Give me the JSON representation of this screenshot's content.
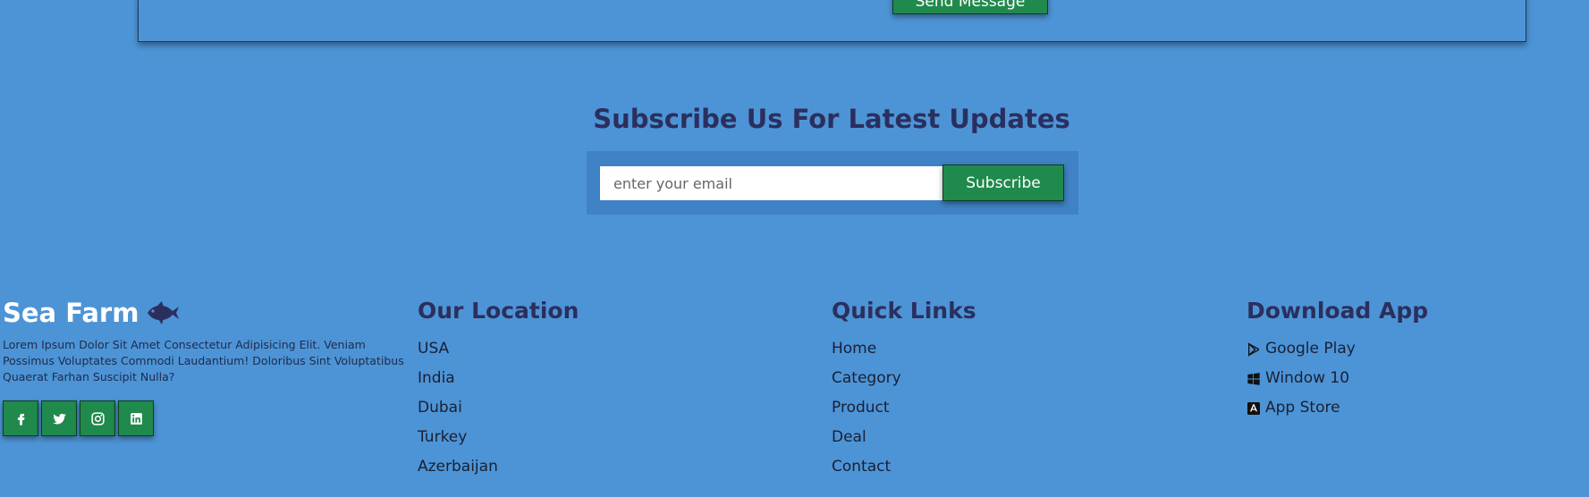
{
  "contact": {
    "send_label": "Send Message"
  },
  "subscribe": {
    "title": "Subscribe Us For Latest Updates",
    "placeholder": "enter your email",
    "button_label": "Subscribe"
  },
  "footer": {
    "brand": {
      "name": "Sea Farm",
      "icon": "fish-icon",
      "description": "Lorem Ipsum Dolor Sit Amet Consectetur Adipisicing Elit. Veniam Possimus Voluptates Commodi Laudantium! Doloribus Sint Voluptatibus Quaerat Farhan Suscipit Nulla?",
      "socials": [
        {
          "icon": "facebook-icon"
        },
        {
          "icon": "twitter-icon"
        },
        {
          "icon": "instagram-icon"
        },
        {
          "icon": "linkedin-icon"
        }
      ]
    },
    "location": {
      "heading": "Our Location",
      "items": [
        "USA",
        "India",
        "Dubai",
        "Turkey",
        "Azerbaijan"
      ]
    },
    "quick_links": {
      "heading": "Quick Links",
      "items": [
        "Home",
        "Category",
        "Product",
        "Deal",
        "Contact"
      ]
    },
    "download": {
      "heading": "Download App",
      "items": [
        {
          "label": "Google Play",
          "icon": "google-play-icon"
        },
        {
          "label": "Window 10",
          "icon": "windows-icon"
        },
        {
          "label": "App Store",
          "icon": "app-store-icon"
        }
      ]
    }
  },
  "colors": {
    "background": "#4d94d6",
    "accent_green": "#1f8a4c",
    "heading_navy": "#2b2f5e",
    "subscribe_box": "#3f82c5"
  }
}
